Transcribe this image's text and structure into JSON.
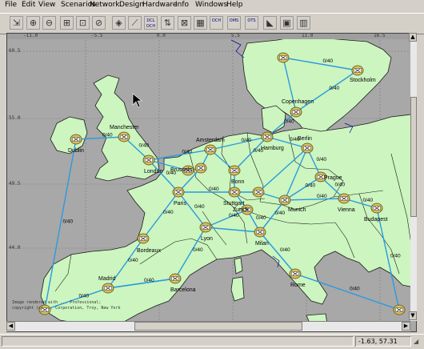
{
  "menu": [
    "File",
    "Edit",
    "View",
    "Scenarios",
    "Network",
    "Design",
    "Hardware",
    "Info",
    "Windows",
    "Help"
  ],
  "toolbar": {
    "buttons": [
      {
        "name": "select-tool-button",
        "icon": "select-icon",
        "label": ""
      },
      {
        "name": "zoom-in-button",
        "icon": "zoom-in-icon",
        "label": ""
      },
      {
        "name": "zoom-out-button",
        "icon": "zoom-out-icon",
        "label": ""
      },
      {
        "name": "zoom-area-button",
        "icon": "zoom-area-icon",
        "label": ""
      },
      {
        "name": "zoom-fit-button",
        "icon": "zoom-fit-icon",
        "label": ""
      },
      {
        "name": "zoom-reset-button",
        "icon": "zoom-reset-icon",
        "label": ""
      },
      {
        "name": "add-node-button",
        "icon": "add-node-icon",
        "label": ""
      },
      {
        "name": "add-link-button",
        "icon": "add-link-icon",
        "label": ""
      },
      {
        "name": "och-button",
        "icon": "och-icon",
        "label": "DCL OCH"
      },
      {
        "name": "connect-button",
        "icon": "connect-icon",
        "label": ""
      },
      {
        "name": "cross-connect-button",
        "icon": "cross-connect-icon",
        "label": ""
      },
      {
        "name": "grid-button",
        "icon": "grid-icon",
        "label": ""
      },
      {
        "name": "och-layer-button",
        "icon": "layer-icon",
        "label": "OCH"
      },
      {
        "name": "oms-layer-button",
        "icon": "layer-icon",
        "label": "OMS"
      },
      {
        "name": "ots-layer-button",
        "icon": "layer-icon",
        "label": "OTS"
      },
      {
        "name": "route-button",
        "icon": "route-icon",
        "label": ""
      },
      {
        "name": "report-button",
        "icon": "report-icon",
        "label": ""
      },
      {
        "name": "tool-button",
        "icon": "tool-icon",
        "label": ""
      }
    ]
  },
  "map": {
    "ruler_top": [
      "-11.0",
      "-5.5",
      "0.0",
      "5.5",
      "11.0",
      "16.5"
    ],
    "ruler_left": [
      "60.5",
      "55.0",
      "49.5",
      "44.0"
    ],
    "cities": [
      {
        "id": "dublin",
        "name": "Dublin"
      },
      {
        "id": "manchester",
        "name": "Manchester"
      },
      {
        "id": "london",
        "name": "London"
      },
      {
        "id": "amsterdam",
        "name": "Amsterdam"
      },
      {
        "id": "brussels",
        "name": "Brussels"
      },
      {
        "id": "paris",
        "name": "Paris"
      },
      {
        "id": "bordeaux",
        "name": "Bordeaux"
      },
      {
        "id": "madrid",
        "name": "Madrid"
      },
      {
        "id": "lisbon",
        "name": ""
      },
      {
        "id": "barcelona",
        "name": "Barcelona"
      },
      {
        "id": "lyon",
        "name": "Lyon"
      },
      {
        "id": "hamburg",
        "name": "Hamburg"
      },
      {
        "id": "bonn",
        "name": "Bonn"
      },
      {
        "id": "frankfurt",
        "name": ""
      },
      {
        "id": "stuttgart",
        "name": "Stuttgart"
      },
      {
        "id": "zurich",
        "name": "Zurich"
      },
      {
        "id": "munich",
        "name": "Munich"
      },
      {
        "id": "nuremberg",
        "name": ""
      },
      {
        "id": "milan",
        "name": "Milan"
      },
      {
        "id": "rome",
        "name": "Rome"
      },
      {
        "id": "berlin",
        "name": "Berlin"
      },
      {
        "id": "prague",
        "name": "Prague"
      },
      {
        "id": "vienna",
        "name": "Vienna"
      },
      {
        "id": "budapest",
        "name": "Budapest"
      },
      {
        "id": "copenhagen",
        "name": "Copenhagen"
      },
      {
        "id": "oslo",
        "name": ""
      },
      {
        "id": "stockholm",
        "name": "Stockholm"
      },
      {
        "id": "south",
        "name": ""
      }
    ],
    "link_label": "0/40",
    "watermark": [
      "Image rendered with ... Professional;",
      "copyright (c) ... Corporation, Troy, New York"
    ]
  },
  "status": {
    "coordinates": "-1.63, 57.31",
    "panel_left": ""
  },
  "colors": {
    "land": "#ccf5bf",
    "sea": "#a8a8a8",
    "link": "#2a9ae0",
    "border": "#1a1a1a",
    "node_fill": "#d8c060",
    "coast_accent": "#0000a0"
  }
}
